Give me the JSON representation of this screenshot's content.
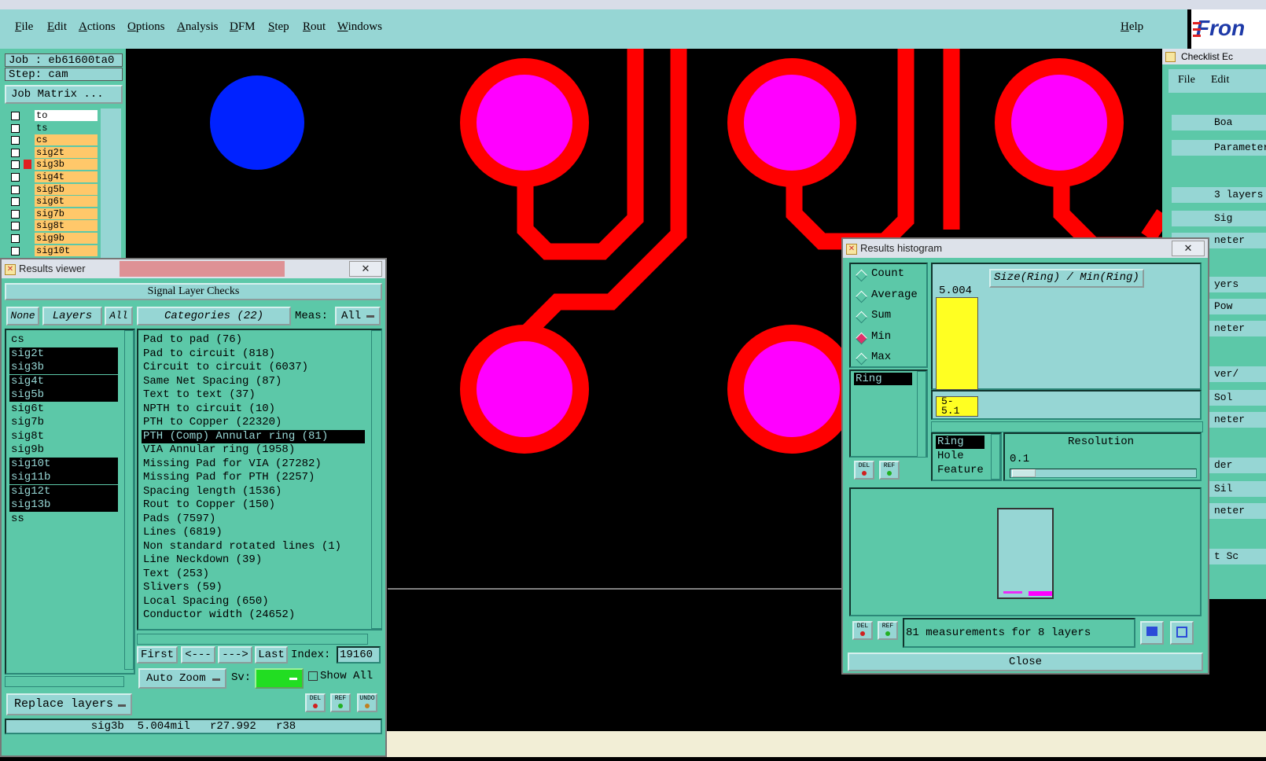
{
  "menubar": {
    "items": [
      "File",
      "Edit",
      "Actions",
      "Options",
      "Analysis",
      "DFM",
      "Step",
      "Rout",
      "Windows"
    ],
    "help": "Help",
    "logo": "Fron"
  },
  "job": {
    "job_line": "Job : eb61600ta0",
    "step_line": "Step: cam",
    "matrix_button": "Job Matrix ..."
  },
  "layer_list": {
    "rows": [
      {
        "name": "to",
        "checked": false
      },
      {
        "name": "ts",
        "checked": false
      },
      {
        "name": "cs",
        "checked": false
      },
      {
        "name": "sig2t",
        "checked": false
      },
      {
        "name": "sig3b",
        "checked": false
      },
      {
        "name": "sig4t",
        "checked": false
      },
      {
        "name": "sig5b",
        "checked": false
      },
      {
        "name": "sig6t",
        "checked": false
      },
      {
        "name": "sig7b",
        "checked": false
      },
      {
        "name": "sig8t",
        "checked": false
      },
      {
        "name": "sig9b",
        "checked": false
      },
      {
        "name": "sig10t",
        "checked": false
      }
    ]
  },
  "results_viewer": {
    "title": "Results viewer",
    "close": "✕",
    "heading": "Signal Layer Checks",
    "tabs": {
      "none": "None",
      "layers": "Layers",
      "all": "All"
    },
    "categories_label": "Categories (22)",
    "meas_label": "Meas:",
    "meas_value": "All",
    "layers": [
      {
        "name": "cs",
        "selected": false
      },
      {
        "name": "sig2t",
        "selected": true
      },
      {
        "name": "sig3b",
        "selected": true
      },
      {
        "name": "sig4t",
        "selected": true
      },
      {
        "name": "sig5b",
        "selected": true
      },
      {
        "name": "sig6t",
        "selected": false
      },
      {
        "name": "sig7b",
        "selected": false
      },
      {
        "name": "sig8t",
        "selected": false
      },
      {
        "name": "sig9b",
        "selected": false
      },
      {
        "name": "sig10t",
        "selected": true
      },
      {
        "name": "sig11b",
        "selected": true
      },
      {
        "name": "sig12t",
        "selected": true
      },
      {
        "name": "sig13b",
        "selected": true
      },
      {
        "name": "ss",
        "selected": false
      }
    ],
    "categories": [
      {
        "label": "Pad to pad (76)",
        "selected": false
      },
      {
        "label": "Pad to circuit (818)",
        "selected": false
      },
      {
        "label": "Circuit to circuit (6037)",
        "selected": false
      },
      {
        "label": "Same Net Spacing (87)",
        "selected": false
      },
      {
        "label": "Text to text (37)",
        "selected": false
      },
      {
        "label": "NPTH to circuit (10)",
        "selected": false
      },
      {
        "label": "PTH to Copper (22320)",
        "selected": false
      },
      {
        "label": "PTH (Comp) Annular ring (81)",
        "selected": true
      },
      {
        "label": "VIA Annular ring (1958)",
        "selected": false
      },
      {
        "label": "Missing Pad for VIA (27282)",
        "selected": false
      },
      {
        "label": "Missing Pad for PTH (2257)",
        "selected": false
      },
      {
        "label": "Spacing length (1536)",
        "selected": false
      },
      {
        "label": "Rout to Copper (150)",
        "selected": false
      },
      {
        "label": "Pads (7597)",
        "selected": false
      },
      {
        "label": "Lines (6819)",
        "selected": false
      },
      {
        "label": "Non standard rotated lines (1)",
        "selected": false
      },
      {
        "label": "Line Neckdown (39)",
        "selected": false
      },
      {
        "label": "Text (253)",
        "selected": false
      },
      {
        "label": "Slivers (59)",
        "selected": false
      },
      {
        "label": "Local Spacing (650)",
        "selected": false
      },
      {
        "label": "Conductor width (24652)",
        "selected": false
      }
    ],
    "nav": {
      "first": "First",
      "prev": "<---",
      "next": "--->",
      "last": "Last",
      "index_label": "Index:",
      "index_value": "19160"
    },
    "auto_zoom": "Auto Zoom",
    "sv_label": "Sv:",
    "show_all": "Show All",
    "replace_layers": "Replace layers",
    "btn_del": "DEL",
    "btn_ref": "REF",
    "btn_undo": "UNDO",
    "status": "sig3b  5.004mil   r27.992   r38"
  },
  "histogram": {
    "title": "Results histogram",
    "close": "✕",
    "modes": [
      {
        "label": "Count",
        "selected": false
      },
      {
        "label": "Average",
        "selected": false
      },
      {
        "label": "Sum",
        "selected": false
      },
      {
        "label": "Min",
        "selected": true
      },
      {
        "label": "Max",
        "selected": false
      }
    ],
    "attr_list": [
      "Ring"
    ],
    "chart_title": "Size(Ring) / Min(Ring)",
    "bar_value": "5.004",
    "bar_label": "5-\n5.1",
    "attr_options": [
      {
        "label": "Ring",
        "selected": true
      },
      {
        "label": "Hole",
        "selected": false
      },
      {
        "label": "Feature",
        "selected": false
      }
    ],
    "resolution_label": "Resolution",
    "resolution_value": "0.1",
    "measurements": "81 measurements for 8 layers",
    "close_button": "Close",
    "btn_del": "DEL",
    "btn_ref": "REF"
  },
  "checklist": {
    "title": "Checklist Ec",
    "menu": [
      "File",
      "Edit"
    ],
    "rows": [
      "Boa",
      "Parameter",
      "3 layers",
      "Sig",
      "neter",
      "yers",
      "Pow",
      "neter",
      "ver/",
      "Sol",
      "neter",
      "der",
      "Sil",
      "neter",
      "t Sc"
    ]
  },
  "colors": {
    "pad": "#ff00ff",
    "copper": "#ff0000",
    "via": "#0022ff",
    "panel": "#5cc8a8",
    "menu": "#96d6d4"
  }
}
